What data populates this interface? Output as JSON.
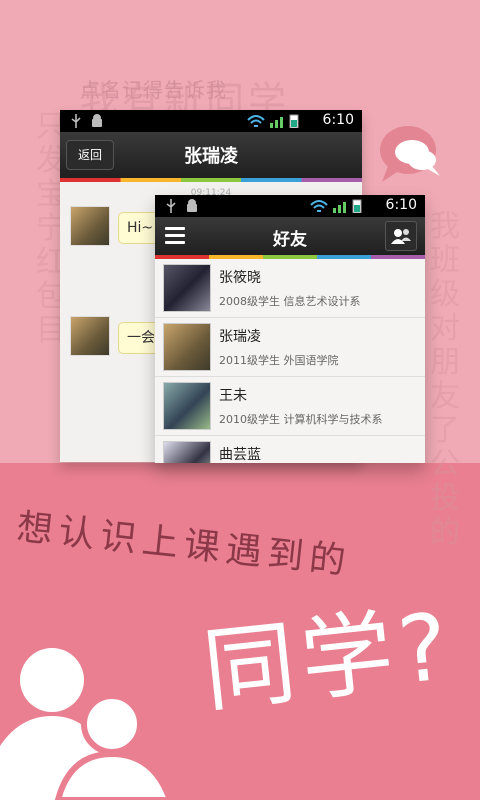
{
  "background": {
    "top_text_small": "点名记得告诉我",
    "top_text_big": "我有新同学",
    "left_column": "只发宝宁红包目",
    "right_column": "我班级对朋友了公投的"
  },
  "back_phone": {
    "status_time": "6:10",
    "back_label": "返回",
    "title": "张瑞凌",
    "chat_time": "09:11:24",
    "messages": [
      "Hi~",
      "一会"
    ]
  },
  "front_phone": {
    "status_time": "6:10",
    "title": "好友",
    "friends": [
      {
        "name": "张筱晓",
        "meta": "2008级学生  信息艺术设计系"
      },
      {
        "name": "张瑞凌",
        "meta": "2011级学生  外国语学院"
      },
      {
        "name": "王未",
        "meta": "2010级学生  计算机科学与技术系"
      },
      {
        "name": "曲芸蓝",
        "meta": ""
      }
    ]
  },
  "slogan": "想认识上课遇到的",
  "big_question": "同学?",
  "colors": {
    "accent_pink": "#e97f90",
    "light_pink": "#f0aab5",
    "slogan": "#8b3848"
  },
  "icons": [
    "speech-bubble-icon",
    "people-icon",
    "menu-icon",
    "add-friend-icon",
    "usb-icon",
    "android-icon",
    "wifi-icon",
    "signal-icon",
    "battery-icon"
  ]
}
